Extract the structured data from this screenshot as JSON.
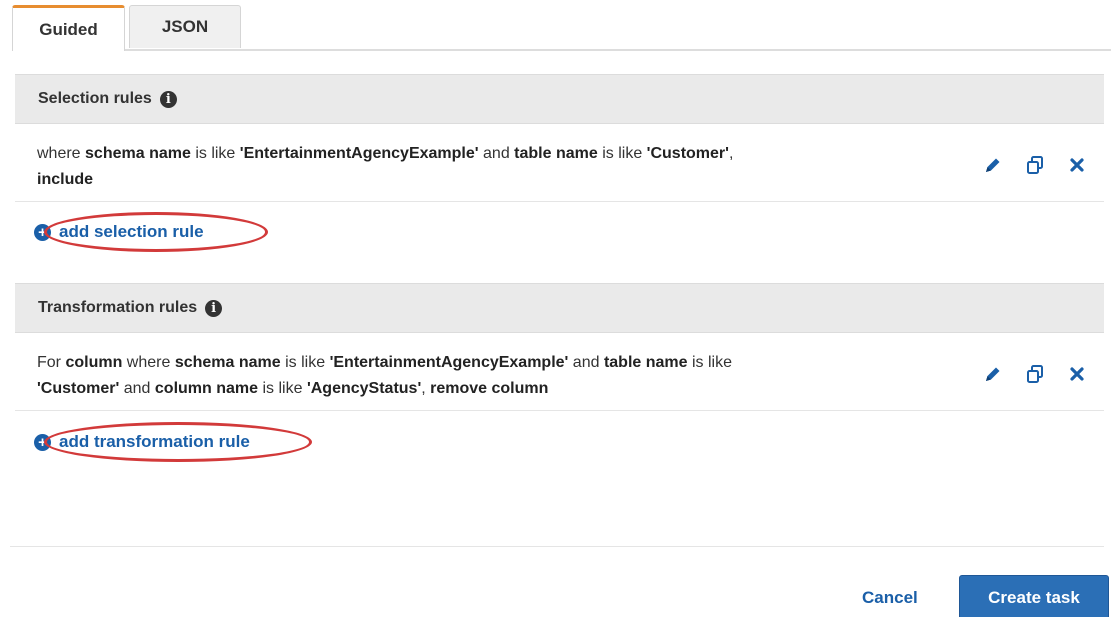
{
  "tabs": [
    {
      "label": "Guided",
      "active": true
    },
    {
      "label": "JSON",
      "active": false
    }
  ],
  "selection": {
    "title": "Selection rules",
    "rule": {
      "t1": "where ",
      "b1": "schema name",
      "t2": " is like ",
      "b2": "'EntertainmentAgencyExample'",
      "t3": " and ",
      "b3": "table name",
      "t4": " is like ",
      "b4": "'Customer'",
      "t5": ",",
      "b5": "include"
    },
    "add_label": "add selection rule"
  },
  "transformation": {
    "title": "Transformation rules",
    "rule": {
      "t1": "For ",
      "b1": "column",
      "t2": " where ",
      "b2": "schema name",
      "t3": " is like ",
      "b3": "'EntertainmentAgencyExample'",
      "t4": " and ",
      "b4": "table name",
      "t5": " is like",
      "b5": "'Customer'",
      "t6": " and ",
      "b6": "column name",
      "t7": " is like ",
      "b7": "'AgencyStatus'",
      "t8": ", ",
      "b8": "remove column"
    },
    "add_label": "add transformation rule"
  },
  "footer": {
    "cancel_label": "Cancel",
    "create_label": "Create task"
  },
  "icons": {
    "edit": "pencil-icon",
    "copy": "copy-icon",
    "delete": "close-icon",
    "info": "info-icon",
    "add": "plus-circle-icon"
  },
  "colors": {
    "accent_tab": "#e78d30",
    "link": "#1a5fa8",
    "primary_button": "#2b6fb6",
    "highlight_ellipse": "#d23a3a"
  }
}
